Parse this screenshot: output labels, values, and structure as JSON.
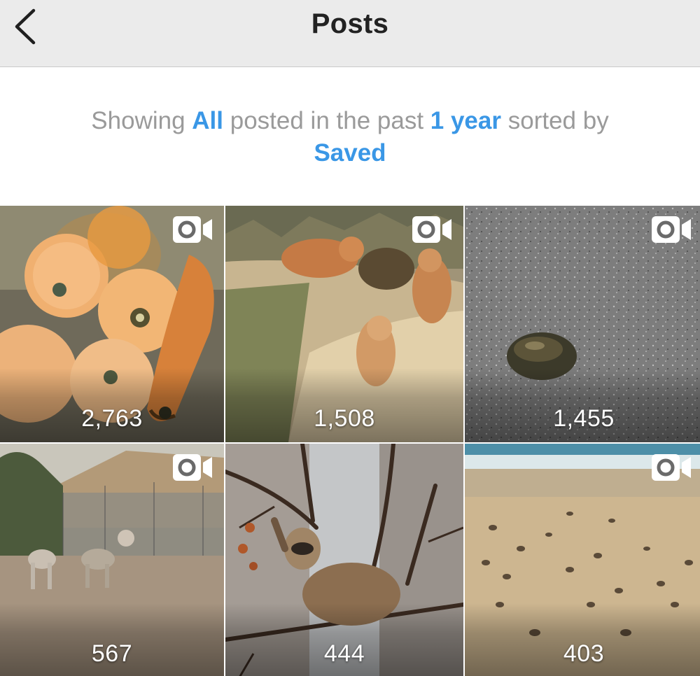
{
  "header": {
    "title": "Posts",
    "back_icon": "chevron-left-icon"
  },
  "summary": {
    "t1": "Showing ",
    "type_filter": "All",
    "t2": " posted in the past ",
    "period_filter": "1 year",
    "t3": " sorted by",
    "sort_filter": "Saved"
  },
  "colors": {
    "link": "#3a97e6",
    "nav_background": "#ebebeb",
    "secondary_text": "#9a9a9a"
  },
  "posts": [
    {
      "count": "2,763",
      "media_icon": "video-camera-icon",
      "subject": "fish eggs"
    },
    {
      "count": "1,508",
      "media_icon": "video-camera-icon",
      "subject": "fox kits"
    },
    {
      "count": "1,455",
      "media_icon": "video-camera-icon",
      "subject": "pebble on asphalt"
    },
    {
      "count": "567",
      "media_icon": "video-camera-icon",
      "subject": "wolves"
    },
    {
      "count": "444",
      "media_icon": "",
      "subject": "raccoon in tree"
    },
    {
      "count": "403",
      "media_icon": "video-camera-icon",
      "subject": "turtle hatchlings on beach"
    }
  ]
}
